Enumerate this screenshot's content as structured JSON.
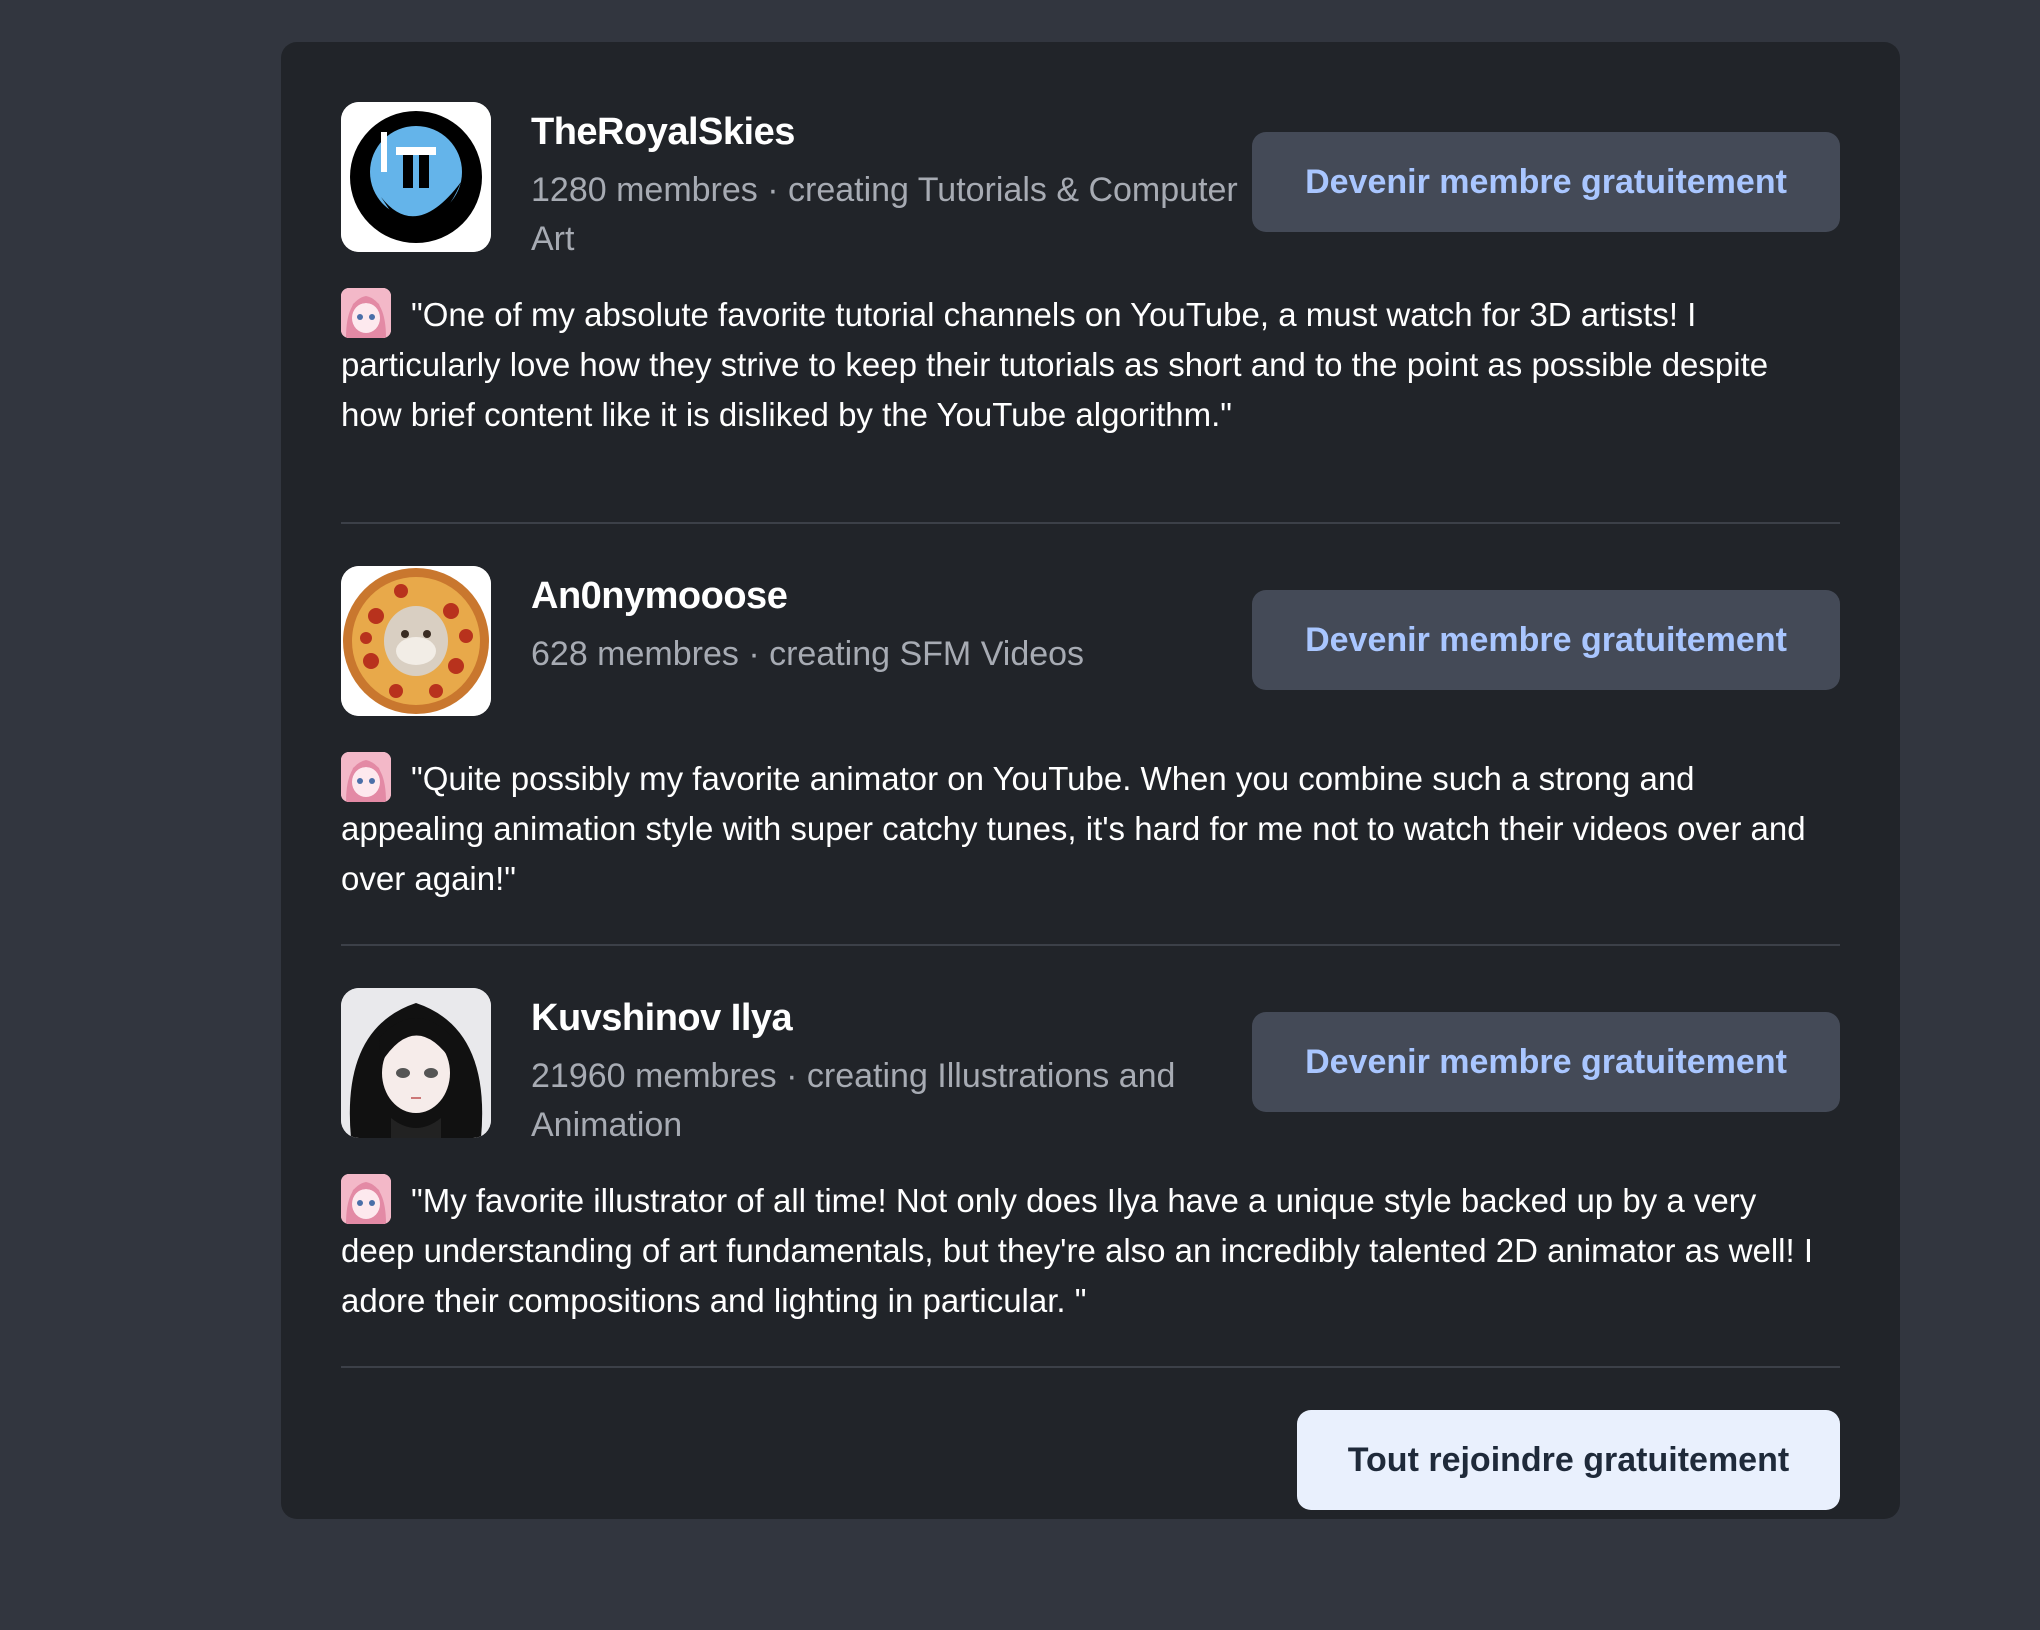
{
  "creators": [
    {
      "name": "TheRoyalSkies",
      "stats": "1280 membres · creating Tutorials & Computer Art",
      "button_label": "Devenir membre gratuitement",
      "quote": "\"One of my absolute favorite tutorial channels on YouTube, a must watch for 3D artists! I particularly love how they strive to keep their tutorials as short and to the point as possible despite how brief content like it is disliked by the YouTube algorithm.\""
    },
    {
      "name": "An0nymooose",
      "stats": "628 membres · creating SFM Videos",
      "button_label": "Devenir membre gratuitement",
      "quote": "\"Quite possibly my favorite animator on YouTube. When you combine such a strong and appealing animation style with super catchy tunes, it's hard for me not to watch their videos over and over again!\""
    },
    {
      "name": "Kuvshinov Ilya",
      "stats": "21960 membres · creating Illustrations and Animation",
      "button_label": "Devenir membre gratuitement",
      "quote": "\"My favorite illustrator of all time! Not only does Ilya have a unique style backed up by a very deep understanding of art fundamentals, but they're also an incredibly talented 2D animator as well! I adore their compositions and lighting in particular. \""
    }
  ],
  "footer": {
    "join_all_label": "Tout rejoindre gratuitement"
  },
  "colors": {
    "page_bg": "#32363f",
    "card_bg": "#212429",
    "secondary_button_bg": "#444a57",
    "secondary_button_text": "#a9c6ff",
    "primary_button_bg": "#e9f0fd"
  },
  "icons": {
    "avatar_1": "royal-skies-logo",
    "avatar_2": "pizza-cat-avatar",
    "avatar_3": "anime-girl-avatar",
    "reviewer": "anime-reviewer-avatar"
  }
}
